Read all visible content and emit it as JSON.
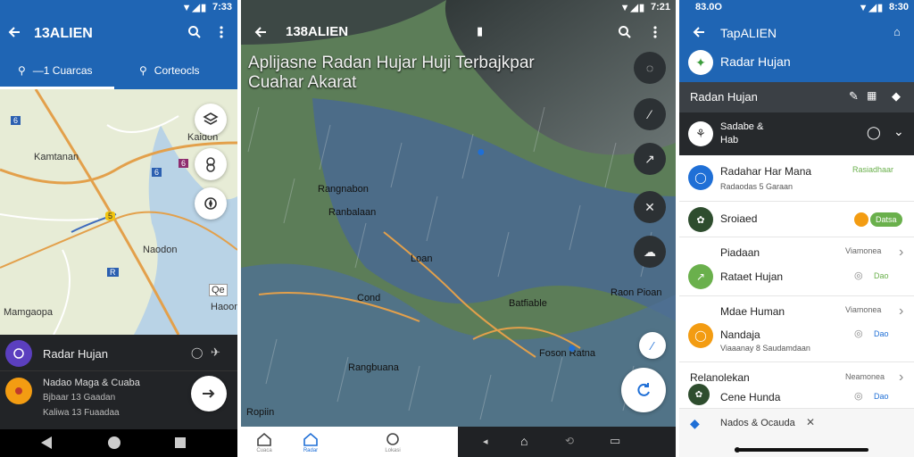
{
  "screen1": {
    "time": "7:33",
    "title": "13ALIEN",
    "tabs": [
      {
        "label": "—1 Cuarcas"
      },
      {
        "label": "Corteocls"
      }
    ],
    "map_labels": {
      "kamtanan": "Kamtanan",
      "kaidoh": "Kaidoh",
      "naodon": "Naodon",
      "haoon": "Haoon",
      "mamgaopa": "Mamgaopa",
      "hwy_1": "5",
      "hwy_2": "6",
      "hwy_3": "6",
      "hwy_4": "R",
      "hwy_5": "6",
      "qe": "Qe"
    },
    "sheet": {
      "title": "Radar Hujan",
      "item_title": "Nadao Maga & Cuaba",
      "item_sub": "Bjbaar 13 Gaadan",
      "item_meta": "Kaliwa 13 Fuaadaa"
    }
  },
  "screen2": {
    "time": "7:21",
    "title": "138ALIEN",
    "headline": "Aplijasne Radan Hujar Huji Terbajkpar Cuahar Akarat",
    "map_labels": {
      "ragnabon": "Rangnabon",
      "cond": "Cond",
      "loan": "Loan",
      "ranbalaan": "Ranbalaan",
      "batfiable": "Batfiable",
      "rangbuana": "Rangbuana",
      "raon_pioan": "Raon Pioan",
      "foson_ratna": "Foson Ratna",
      "ropiin": "Ropiin"
    },
    "nav": [
      {
        "label": "Cuaca"
      },
      {
        "label": "Radar"
      },
      {
        "label": "Lokasi"
      }
    ]
  },
  "screen3": {
    "time": "8:30",
    "status_left": "83.0O",
    "title": "TapALIEN",
    "subtitle": "Radar Hujan",
    "section_header": "Radan Hujan",
    "dark_row": {
      "line1": "Sadabe &",
      "line2": "Hab"
    },
    "rows": [
      {
        "title": "Radahar Har Mana",
        "sub": "Radaodas 5 Garaan",
        "tag": "Rasiadhaar"
      },
      {
        "title": "Sroiaed",
        "chip": "Datsa"
      },
      {
        "title": "Piadaan",
        "tag": "Viamonea"
      },
      {
        "title": "Rataet Hujan",
        "chip": "Dao"
      },
      {
        "title": "Mdae Human",
        "tag": "Viamonea"
      },
      {
        "title": "Nandaja",
        "sub": "Viaaanay 8 Saudamdaan",
        "chip": "Dao"
      }
    ],
    "section2": {
      "title": "Relanolekan",
      "tag": "Neamonea"
    },
    "last_row": {
      "title": "Cene Hunda",
      "chip": "Dao"
    },
    "bottom": {
      "text": "Nados & Ocauda"
    }
  },
  "colors": {
    "primary": "#1f65b4",
    "dark_sheet": "#222427",
    "accent_green": "#6ab04c",
    "accent_orange": "#f39c12"
  }
}
